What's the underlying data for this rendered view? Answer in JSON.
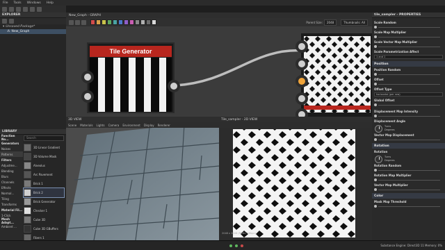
{
  "menu": [
    "File",
    "Tools",
    "Windows",
    "Help"
  ],
  "explorer": {
    "title": "EXPLORER",
    "package": "Unsaved Package*",
    "graph": "New_Graph"
  },
  "graph": {
    "tab_label": "New_Graph - GRAPH",
    "parent_size_label": "Parent Size:",
    "parent_size_value": "2048",
    "thumbnails_label": "Thumbnails: All",
    "node_title": "Tile Generator",
    "swatch_colors": [
      "#d14b4b",
      "#d9a04a",
      "#c9c34b",
      "#5ea65e",
      "#4aa3a3",
      "#4a78c9",
      "#8e5ec9",
      "#c95eb2",
      "#888888",
      "#b0b0b0",
      "#6a6a6a",
      "#d9d9d9"
    ]
  },
  "view3d": {
    "title": "3D VIEW",
    "menu": [
      "Scene",
      "Materials",
      "Lights",
      "Camera",
      "Environment",
      "Display",
      "Renderer"
    ]
  },
  "view2d": {
    "title": "Tile_sampler - 2D VIEW",
    "footer": "2048 x 2048 (RGBA, 16bpc)"
  },
  "library": {
    "title": "LIBRARY",
    "search_placeholder": "Search",
    "categories": [
      {
        "label": "Function No...",
        "bold": true
      },
      {
        "label": "Generators",
        "bold": true
      },
      {
        "label": "Noises",
        "bold": false
      },
      {
        "label": "Patterns",
        "bold": false,
        "selected": true
      },
      {
        "label": "Filters",
        "bold": true
      },
      {
        "label": "Adjustme...",
        "bold": false
      },
      {
        "label": "Blending",
        "bold": false
      },
      {
        "label": "Blurs",
        "bold": false
      },
      {
        "label": "Channels",
        "bold": false
      },
      {
        "label": "Effects",
        "bold": false
      },
      {
        "label": "Normal...",
        "bold": false
      },
      {
        "label": "Tiling",
        "bold": false
      },
      {
        "label": "Transforms",
        "bold": false
      },
      {
        "label": "Material Fil...",
        "bold": true
      },
      {
        "label": "1-Click",
        "bold": false
      },
      {
        "label": "Mesh Adapt...",
        "bold": true
      },
      {
        "label": "Ambient ...",
        "bold": false
      }
    ],
    "items": [
      {
        "label": "3D Linear Gradient",
        "thumb": "#6a6a6a"
      },
      {
        "label": "3D Volume Mask",
        "thumb": "#444444"
      },
      {
        "label": "Alveolus",
        "thumb": "#888888"
      },
      {
        "label": "Arc Pavement",
        "thumb": "#555555"
      },
      {
        "label": "Brick 1",
        "thumb": "#7a7a7a"
      },
      {
        "label": "Brick 2",
        "thumb": "#d0d0d0",
        "selected": true
      },
      {
        "label": "Brick Generator",
        "thumb": "#999999"
      },
      {
        "label": "Checker 1",
        "thumb": "#e0e0e0"
      },
      {
        "label": "Cube 3D",
        "thumb": "#777777"
      },
      {
        "label": "Cube 3D GBuffers",
        "thumb": "#333333"
      },
      {
        "label": "Fibers 1",
        "thumb": "#666666"
      }
    ]
  },
  "properties": {
    "title": "tile_sampler - PROPERTIES",
    "rows_top": [
      "Scale Random",
      "Scale Map Multiplier",
      "Scale Vector Map Multiplier",
      "Scale Parametrization Affect"
    ],
    "parametrization_value": "1 and 1",
    "section_position": "Position",
    "position_rows": [
      "Position Random",
      "Offset",
      "Offset Type"
    ],
    "offset_type_value": "horizontal (per row)",
    "global_offset_label": "Global Offset",
    "disp_intensity_label": "Displacement Map Intensity",
    "disp_angle_label": "Displacement Angle",
    "angle_text_1": "Turns",
    "angle_text_2": "Degrees",
    "vector_disp_label": "Vector Map Displacement",
    "section_rotation": "Rotation",
    "rotation_label": "Rotation",
    "rotation_random_label": "Rotation Random",
    "rotation_map_mult_label": "Rotation Map Multiplier",
    "vector_map_mult_label": "Vector Map Multiplier",
    "section_color": "Color",
    "mask_threshold_label": "Mask Map Threshold"
  },
  "status": {
    "text": "Substance Engine: Direct3D 11  Memory: 0%"
  }
}
